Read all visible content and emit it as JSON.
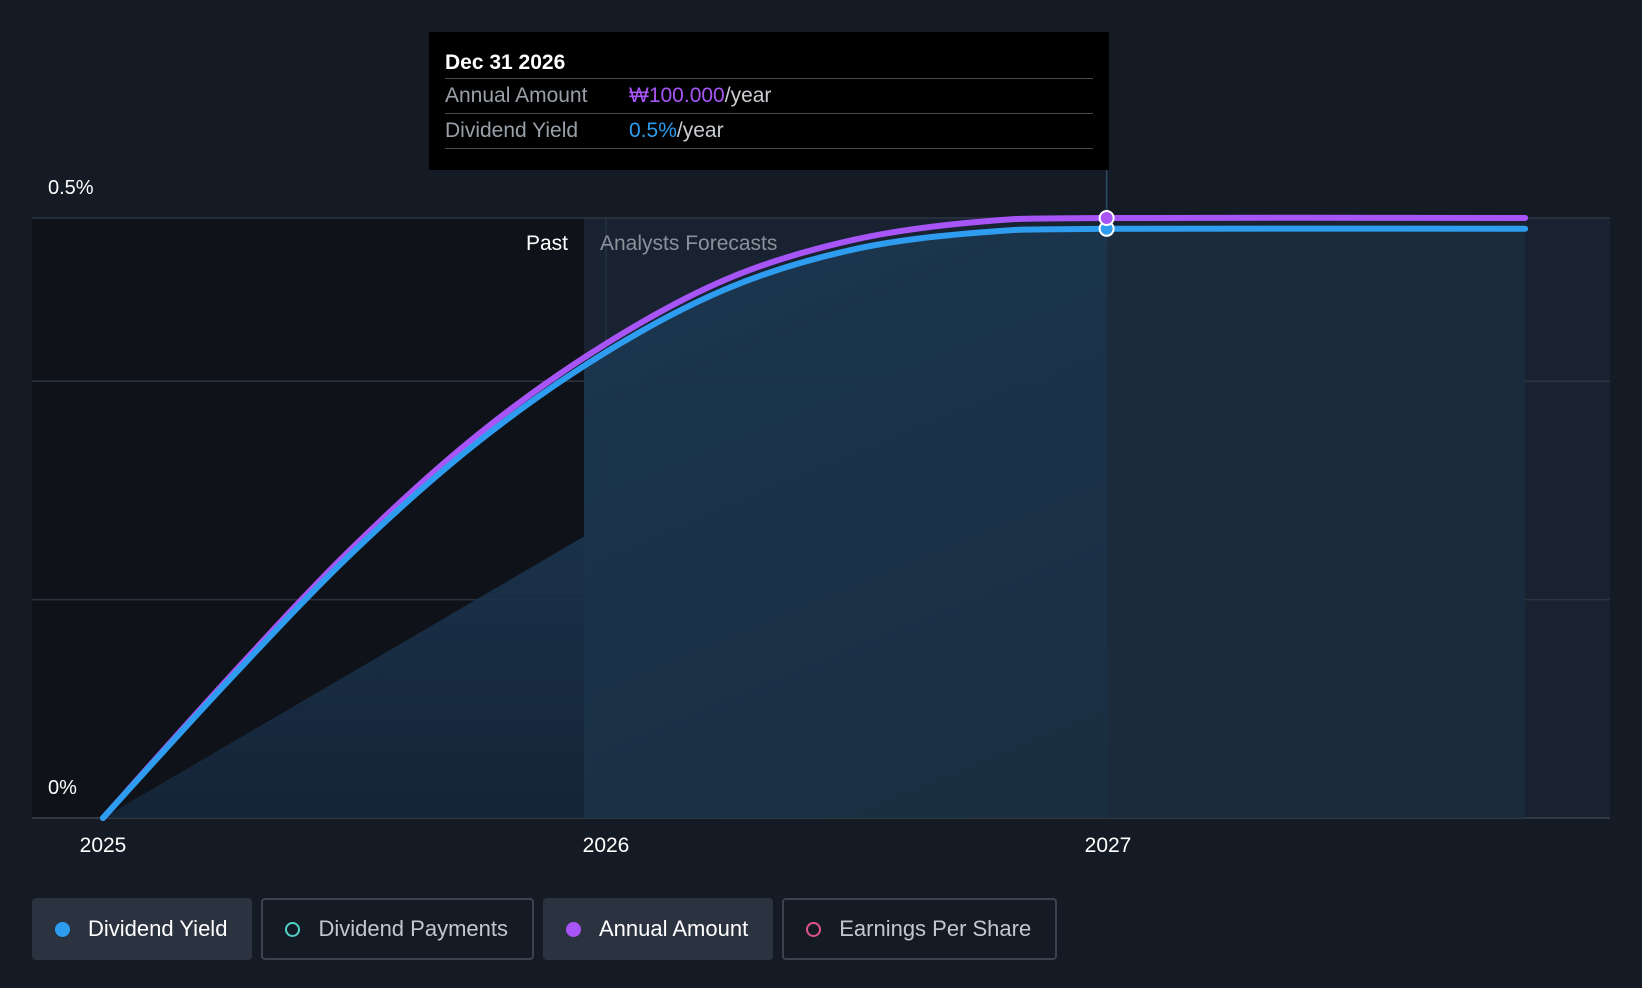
{
  "tooltip": {
    "date": "Dec 31 2026",
    "rows": [
      {
        "label": "Annual Amount",
        "value": "₩100.000",
        "unit": "/year"
      },
      {
        "label": "Dividend Yield",
        "value": "0.5%",
        "unit": "/year"
      }
    ]
  },
  "regions": {
    "past_label": "Past",
    "forecast_label": "Analysts Forecasts"
  },
  "legend": {
    "items": [
      {
        "label": "Dividend Yield",
        "color": "#2e9df0",
        "active": true
      },
      {
        "label": "Dividend Payments",
        "color": "#4fd1c5",
        "active": false
      },
      {
        "label": "Annual Amount",
        "color": "#a855f7",
        "active": true
      },
      {
        "label": "Earnings Per Share",
        "color": "#e0548e",
        "active": false
      }
    ]
  },
  "chart_data": {
    "type": "line",
    "x_ticks": [
      "2025",
      "2026",
      "2027"
    ],
    "y_ticks": [
      "0.5%",
      "0%"
    ],
    "ylim": [
      0,
      0.5
    ],
    "grid": true,
    "past_end": "2025-12-31",
    "highlight_x": "2026-12-31",
    "series": [
      {
        "name": "Annual Amount",
        "color": "#a855f7",
        "points": [
          {
            "x": "2025-01-01",
            "y": 0.0
          },
          {
            "x": "2025-04-01",
            "y": 0.115
          },
          {
            "x": "2025-07-01",
            "y": 0.225
          },
          {
            "x": "2025-10-01",
            "y": 0.32
          },
          {
            "x": "2026-01-01",
            "y": 0.395
          },
          {
            "x": "2026-04-01",
            "y": 0.45
          },
          {
            "x": "2026-07-01",
            "y": 0.482
          },
          {
            "x": "2026-10-01",
            "y": 0.497
          },
          {
            "x": "2026-12-31",
            "y": 0.5
          },
          {
            "x": "2027-10-31",
            "y": 0.5
          }
        ]
      },
      {
        "name": "Dividend Yield",
        "color": "#2e9df0",
        "points": [
          {
            "x": "2025-01-01",
            "y": 0.0
          },
          {
            "x": "2025-04-01",
            "y": 0.113
          },
          {
            "x": "2025-07-01",
            "y": 0.221
          },
          {
            "x": "2025-10-01",
            "y": 0.314
          },
          {
            "x": "2026-01-01",
            "y": 0.388
          },
          {
            "x": "2026-04-01",
            "y": 0.442
          },
          {
            "x": "2026-07-01",
            "y": 0.474
          },
          {
            "x": "2026-10-01",
            "y": 0.488
          },
          {
            "x": "2026-12-31",
            "y": 0.491
          },
          {
            "x": "2027-10-31",
            "y": 0.491
          }
        ]
      },
      {
        "name": "Dividend Payments",
        "color": "#2a4a66",
        "points": [
          {
            "x": "2025-01-01",
            "y": 0.0
          },
          {
            "x": "2025-12-20",
            "y": 0.237
          }
        ]
      }
    ]
  }
}
